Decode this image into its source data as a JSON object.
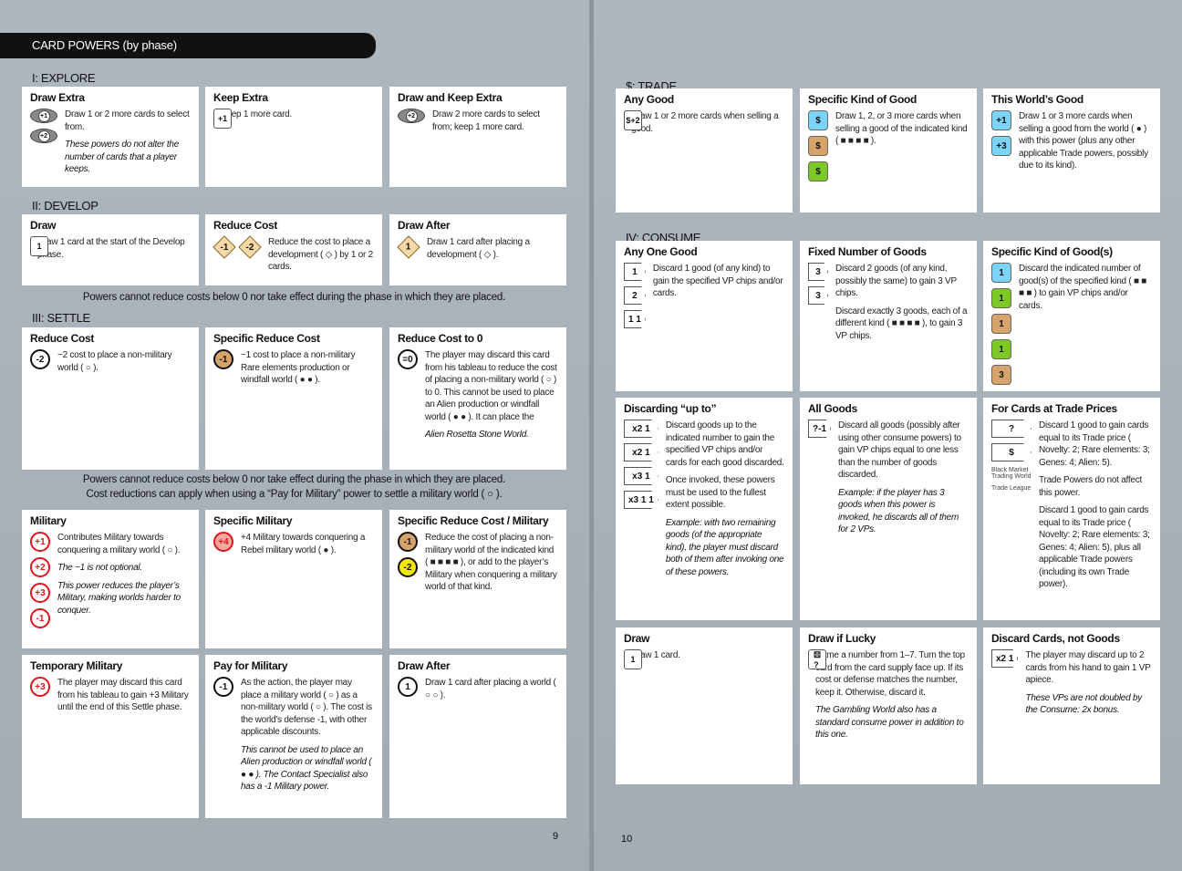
{
  "title": "CARD POWERS (by phase)",
  "colors": {
    "novelty": "#7dd3f5",
    "rare": "#d6a46a",
    "genes": "#7cc825",
    "alien": "#f5e800",
    "military": "#e3141b",
    "page_bg": "#aab2bb"
  },
  "left_page": {
    "page_number": "9",
    "sections": [
      {
        "heading": "I: EXPLORE",
        "cards": [
          {
            "title": "Draw Extra",
            "icons": [
              {
                "name": "explore-plus1-icon",
                "shape": "eye",
                "label": "+1"
              },
              {
                "name": "explore-plus2-icon",
                "shape": "eye",
                "label": "+2"
              }
            ],
            "paras": [
              {
                "t": "Draw 1 or 2 more cards to select from."
              },
              {
                "t": "These powers do not alter the number of cards that a player keeps.",
                "it": true
              }
            ]
          },
          {
            "title": "Keep Extra",
            "icons": [
              {
                "name": "keep-card-icon",
                "shape": "card",
                "label": "+1"
              }
            ],
            "paras": [
              {
                "t": "Keep 1 more card."
              }
            ]
          },
          {
            "title": "Draw and Keep Extra",
            "icons": [
              {
                "name": "draw-keep-icon",
                "shape": "eye",
                "label": "+2"
              }
            ],
            "paras": [
              {
                "t": "Draw 2 more cards to select from; keep 1 more card."
              }
            ]
          }
        ]
      },
      {
        "heading": "II: DEVELOP",
        "cards": [
          {
            "title": "Draw",
            "icons": [
              {
                "name": "draw-card-icon",
                "shape": "card",
                "label": "1"
              }
            ],
            "paras": [
              {
                "t": "Draw 1 card at the start of the Develop phase."
              }
            ]
          },
          {
            "title": "Reduce Cost",
            "icons": [
              {
                "name": "reduce-diamond-icon",
                "shape": "diamond",
                "label": "-1",
                "row": true
              },
              {
                "name": "reduce-diamond-icon",
                "shape": "diamond",
                "label": "-2",
                "row": true
              }
            ],
            "paras": [
              {
                "t": "Reduce the cost to place a development ( ◇ ) by 1 or 2 cards."
              }
            ]
          },
          {
            "title": "Draw After",
            "icons": [
              {
                "name": "development-draw-icon",
                "shape": "diamond",
                "label": "1"
              }
            ],
            "paras": [
              {
                "t": "Draw 1 card after placing a development ( ◇ )."
              }
            ]
          }
        ],
        "note": [
          "Powers cannot reduce costs below 0 nor take effect during the phase in which they are placed."
        ]
      },
      {
        "heading": "III: SETTLE",
        "cards": [
          {
            "title": "Reduce Cost",
            "icons": [
              {
                "name": "reduce-cost-icon",
                "shape": "circle",
                "label": "-2"
              }
            ],
            "paras": [
              {
                "t": "−2 cost to place a non-military world ( ○ )."
              }
            ]
          },
          {
            "title": "Specific Reduce Cost",
            "icons": [
              {
                "name": "specific-reduce-icon",
                "shape": "circle",
                "label": "-1",
                "fill": "#d6a46a"
              }
            ],
            "paras": [
              {
                "t": "−1 cost to place a non-military Rare elements production or windfall world ( ● ● )."
              }
            ]
          },
          {
            "title": "Reduce Cost to 0",
            "icons": [
              {
                "name": "discard-to-zero-icon",
                "shape": "circle",
                "label": "=0"
              }
            ],
            "paras": [
              {
                "t": "The player may discard this card from his tableau to reduce the cost of placing a non-military world ( ○ ) to 0. This cannot be used to place an Alien production or windfall world ( ● ● ). It can place the"
              },
              {
                "t": "Alien Rosetta Stone World.",
                "it": true
              }
            ]
          }
        ],
        "note": [
          "Powers cannot reduce costs below 0 nor take effect during the phase in which they are placed.",
          "Cost reductions can apply when using a “Pay for Military” power to settle a military world ( ○ )."
        ]
      },
      {
        "heading": "",
        "cards": [
          {
            "title": "Military",
            "icons": [
              {
                "name": "military-plus1-icon",
                "shape": "circle",
                "label": "+1",
                "red": true
              },
              {
                "name": "military-plus2-icon",
                "shape": "circle",
                "label": "+2",
                "red": true
              },
              {
                "name": "military-plus3-icon",
                "shape": "circle",
                "label": "+3",
                "red": true
              },
              {
                "name": "military-minus1-icon",
                "shape": "circle",
                "label": "-1",
                "red": true
              }
            ],
            "paras": [
              {
                "t": "Contributes Military towards conquering a military world ( ○ )."
              },
              {
                "t": "The −1 is not optional.",
                "it": true
              },
              {
                "t": "This power reduces the player’s Military, making worlds harder to conquer.",
                "it": true
              }
            ]
          },
          {
            "title": "Specific Military",
            "icons": [
              {
                "name": "rebel-military-icon",
                "shape": "circle",
                "label": "+4",
                "red": true,
                "fill": "#f4a9a0"
              }
            ],
            "paras": [
              {
                "t": "+4 Military towards conquering a Rebel military world ( ● )."
              }
            ]
          },
          {
            "title": "Specific Reduce Cost / Military",
            "icons": [
              {
                "name": "rare-reduce-military-icon",
                "shape": "circle",
                "label": "-1",
                "fill": "#d6a46a"
              },
              {
                "name": "alien-reduce-military-icon",
                "shape": "circle",
                "label": "-2",
                "fill": "#f5e800"
              }
            ],
            "paras": [
              {
                "t": "Reduce the cost of placing a non-military world of the indicated kind ( ■ ■ ■ ■ ), or add to the player’s Military when conquering a military world of that kind."
              }
            ]
          },
          {
            "title": "Temporary Military",
            "icons": [
              {
                "name": "discard-military-icon",
                "shape": "circle",
                "label": "+3",
                "red": true
              }
            ],
            "paras": [
              {
                "t": "The player may discard this card from his tableau to gain +3 Military until the end of this Settle phase."
              }
            ]
          },
          {
            "title": "Pay for Military",
            "icons": [
              {
                "name": "pay-military-icon",
                "shape": "circle",
                "label": "-1"
              }
            ],
            "paras": [
              {
                "t": "As the action, the player may place a military world ( ○ ) as a non-military world ( ○ ). The cost is the world’s defense -1, with other applicable discounts."
              },
              {
                "t": "This cannot be used to place an Alien production or windfall world ( ● ● ). The Contact Specialist also has a -1 Military power.",
                "it": true
              }
            ]
          },
          {
            "title": "Draw After",
            "icons": [
              {
                "name": "world-draw-icon",
                "shape": "circle",
                "label": "1"
              }
            ],
            "paras": [
              {
                "t": "Draw 1 card after placing a world ( ○ ○ )."
              }
            ]
          }
        ]
      }
    ]
  },
  "right_page": {
    "page_number": "10",
    "sections": [
      {
        "heading": "$: TRADE",
        "cards": [
          {
            "title": "Any Good",
            "icons": [
              {
                "name": "trade-plus1-icon",
                "shape": "card",
                "label": "$+1"
              },
              {
                "name": "trade-plus2-icon",
                "shape": "card",
                "label": "$+2"
              }
            ],
            "paras": [
              {
                "t": "Draw 1 or 2 more cards when selling a good."
              }
            ]
          },
          {
            "title": "Specific Kind of Good",
            "icons": [
              {
                "name": "novelty-good-icon",
                "shape": "good",
                "label": "$",
                "fill": "#7dd3f5"
              },
              {
                "name": "rare-good-icon",
                "shape": "good",
                "label": "$",
                "fill": "#d6a46a"
              },
              {
                "name": "genes-good-icon",
                "shape": "good",
                "label": "$",
                "fill": "#7cc825"
              }
            ],
            "paras": [
              {
                "t": "Draw 1, 2, or 3 more cards when selling a good of the indicated kind ( ■ ■ ■ ■ )."
              }
            ]
          },
          {
            "title": "This World’s Good",
            "icons": [
              {
                "name": "world-good-plus1-icon",
                "shape": "good",
                "label": "+1",
                "fill": "#7dd3f5"
              },
              {
                "name": "world-good-plus3-icon",
                "shape": "good",
                "label": "+3",
                "fill": "#7dd3f5"
              }
            ],
            "paras": [
              {
                "t": "Draw 1 or 3 more cards when selling a good from the world ( ● ) with this power (plus any other applicable Trade powers, possibly due to its kind)."
              }
            ]
          }
        ]
      },
      {
        "heading": "IV: CONSUME",
        "cards": [
          {
            "title": "Any One Good",
            "icons": [
              {
                "name": "any-good-vp1-icon",
                "shape": "hex",
                "label": "1"
              },
              {
                "name": "any-good-vp2-icon",
                "shape": "hex",
                "label": "2"
              },
              {
                "name": "any-good-vp-card-icon",
                "shape": "hex",
                "label": "1 1"
              }
            ],
            "paras": [
              {
                "t": "Discard 1 good (of any kind) to gain the specified VP chips and/or cards."
              }
            ]
          },
          {
            "title": "Fixed Number of Goods",
            "icons": [
              {
                "name": "two-goods-icon",
                "shape": "hex",
                "label": "3"
              },
              {
                "name": "three-kinds-icon",
                "shape": "hex",
                "label": "3"
              }
            ],
            "paras": [
              {
                "t": "Discard 2 goods (of any kind, possibly the same) to gain 3 VP chips."
              },
              {
                "t": "Discard exactly 3 goods, each of a different kind ( ■ ■ ■ ■ ), to gain 3 VP chips."
              }
            ]
          },
          {
            "title": "Specific Kind of Good(s)",
            "icons": [
              {
                "name": "novelty-consume-icon",
                "shape": "good",
                "label": "1",
                "fill": "#7dd3f5"
              },
              {
                "name": "genes-consume-icon",
                "shape": "good",
                "label": "1",
                "fill": "#7cc825"
              },
              {
                "name": "rare-consume-icon",
                "shape": "good",
                "label": "1",
                "fill": "#d6a46a"
              },
              {
                "name": "genes-consume-icon",
                "shape": "good",
                "label": "1",
                "fill": "#7cc825"
              },
              {
                "name": "rare-pair-consume-icon",
                "shape": "good",
                "label": "3",
                "fill": "#d6a46a"
              }
            ],
            "paras": [
              {
                "t": "Discard the indicated number of good(s) of the specified kind ( ■ ■ ■ ■ ) to gain VP chips and/or cards."
              }
            ]
          },
          {
            "title": "Discarding “up to”",
            "icons": [
              {
                "name": "upto-x2-icon",
                "shape": "hex",
                "label": "x2 1"
              },
              {
                "name": "upto-x2-rare-icon",
                "shape": "hex",
                "label": "x2 1"
              },
              {
                "name": "upto-x3-icon",
                "shape": "hex",
                "label": "x3 1"
              },
              {
                "name": "upto-x3-card-icon",
                "shape": "hex",
                "label": "x3 1 1"
              }
            ],
            "paras": [
              {
                "t": "Discard goods up to the indicated number to gain the specified VP chips and/or cards for each good discarded."
              },
              {
                "t": "Once invoked, these powers must be used to the fullest extent possible."
              },
              {
                "t": "Example: with two remaining goods (of the appropriate kind), the player must discard both of them after invoking one of these powers.",
                "it": true
              }
            ]
          },
          {
            "title": "All Goods",
            "icons": [
              {
                "name": "all-goods-icon",
                "shape": "hex",
                "label": "?-1"
              }
            ],
            "paras": [
              {
                "t": "Discard all goods (possibly after using other consume powers) to gain VP chips equal to one less than the number of goods discarded."
              },
              {
                "t": "Example: if the player has 3 goods when this power is invoked, he discards all of them for 2 VPs.",
                "it": true
              }
            ]
          },
          {
            "title": "For Cards at Trade Prices",
            "icons": [
              {
                "name": "trade-price-icon",
                "shape": "hex",
                "label": "?"
              },
              {
                "name": "trade-league-icon",
                "shape": "hex",
                "label": "$"
              }
            ],
            "captions": [
              "Black Market Trading World",
              "Trade League"
            ],
            "paras": [
              {
                "t": "Discard 1 good to gain cards equal to its Trade price ( Novelty: 2; Rare elements: 3; Genes: 4; Alien: 5)."
              },
              {
                "t": "Trade Powers do not affect this power."
              },
              {
                "t": "Discard 1 good to gain cards equal to its Trade price ( Novelty: 2; Rare elements: 3; Genes: 4; Alien: 5), plus all applicable Trade powers (including its own Trade power)."
              }
            ]
          },
          {
            "title": "Draw",
            "icons": [
              {
                "name": "consume-draw-icon",
                "shape": "card",
                "label": "1"
              }
            ],
            "paras": [
              {
                "t": "Draw 1 card."
              }
            ]
          },
          {
            "title": "Draw if Lucky",
            "icons": [
              {
                "name": "dice-icon",
                "shape": "card",
                "label": "⚄ ?"
              }
            ],
            "paras": [
              {
                "t": "Name a number from 1–7. Turn the top card from the card supply face up. If its cost or defense matches the number, keep it. Otherwise, discard it."
              },
              {
                "t": "The Gambling World also has a standard consume power in addition to this one.",
                "it": true
              }
            ]
          },
          {
            "title": "Discard Cards, not Goods",
            "icons": [
              {
                "name": "discard-cards-icon",
                "shape": "hex",
                "label": "x2 1"
              }
            ],
            "paras": [
              {
                "t": "The player may discard up to 2 cards from his hand to gain 1 VP apiece."
              },
              {
                "t": "These VPs are not doubled by the Consume: 2x bonus.",
                "it": true
              }
            ]
          }
        ]
      }
    ]
  }
}
